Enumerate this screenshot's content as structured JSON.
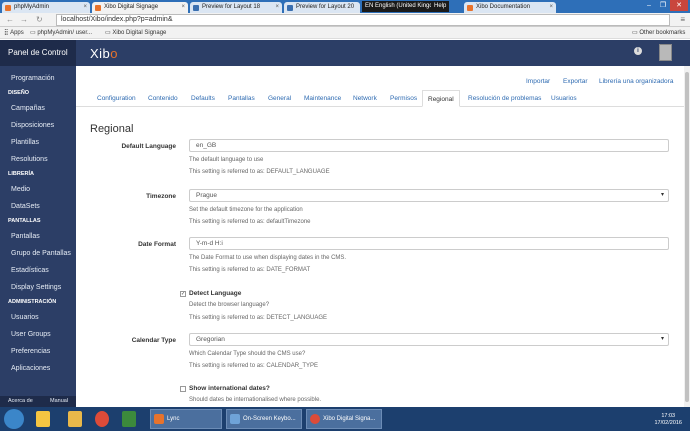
{
  "browser": {
    "tabs": [
      {
        "label": "phpMyAdmin"
      },
      {
        "label": "Xibo Digital Signage"
      },
      {
        "label": "Preview for Layout 18"
      },
      {
        "label": "Preview for Layout 20"
      },
      {
        "label": "Xibo Documentation"
      }
    ],
    "lang_badge": "EN English (United Kingdom)",
    "help_label": "Help",
    "url": "localhost/Xibo/index.php?p=admin&",
    "bookmarks": {
      "apps": "Apps",
      "phpmyadmin": "phpMyAdmin/ user...",
      "xibo": "Xibo Digital Signage",
      "other": "Other bookmarks"
    }
  },
  "sidebar": {
    "title": "Panel de Control",
    "items": [
      {
        "label": "Programación"
      },
      {
        "section": "DISEÑO"
      },
      {
        "label": "Campañas"
      },
      {
        "label": "Disposiciones"
      },
      {
        "label": "Plantillas"
      },
      {
        "label": "Resolutions"
      },
      {
        "section": "LIBRERÍA"
      },
      {
        "label": "Medio"
      },
      {
        "label": "DataSets"
      },
      {
        "section": "PANTALLAS"
      },
      {
        "label": "Pantallas"
      },
      {
        "label": "Grupo de Pantallas"
      },
      {
        "label": "Estadísticas"
      },
      {
        "label": "Display Settings"
      },
      {
        "section": "ADMINISTRACIÓN"
      },
      {
        "label": "Usuarios"
      },
      {
        "label": "User Groups"
      },
      {
        "label": "Preferencias"
      },
      {
        "label": "Aplicaciones"
      }
    ],
    "footer": {
      "about": "Acerca de",
      "manual": "Manual"
    }
  },
  "header": {
    "logo_main": "Xib",
    "logo_accent": "o"
  },
  "main": {
    "top_links": [
      "Importar",
      "Exportar",
      "Librería una organizadora"
    ],
    "tabs": [
      {
        "label": "Configuration"
      },
      {
        "label": "Contenido"
      },
      {
        "label": "Defaults"
      },
      {
        "label": "Pantallas"
      },
      {
        "label": "General"
      },
      {
        "label": "Maintenance"
      },
      {
        "label": "Network"
      },
      {
        "label": "Permisos"
      },
      {
        "label": "Regional"
      },
      {
        "label": "Resolución de problemas"
      },
      {
        "label": "Usuarios"
      }
    ],
    "section_title": "Regional",
    "fields": {
      "default_language": {
        "label": "Default Language",
        "value": "en_GB",
        "help": "The default language to use",
        "ref": "This setting is referred to as: DEFAULT_LANGUAGE"
      },
      "timezone": {
        "label": "Timezone",
        "value": "Prague",
        "help": "Set the default timezone for the application",
        "ref": "This setting is referred to as: defaultTimezone"
      },
      "date_format": {
        "label": "Date Format",
        "value": "Y-m-d H:i",
        "help": "The Date Format to use when displaying dates in the CMS.",
        "ref": "This setting is referred to as: DATE_FORMAT"
      },
      "detect_language": {
        "label": "Detect Language",
        "checked": true,
        "help": "Detect the browser language?",
        "ref": "This setting is referred to as: DETECT_LANGUAGE"
      },
      "calendar_type": {
        "label": "Calendar Type",
        "value": "Gregorian",
        "help": "Which Calendar Type should the CMS use?",
        "ref": "This setting is referred to as: CALENDAR_TYPE"
      },
      "show_international_dates": {
        "label": "Show international dates?",
        "checked": false,
        "help": "Should dates be internationalised where possible."
      }
    }
  },
  "taskbar": {
    "apps": [
      {
        "label": "Lync"
      },
      {
        "label": "On-Screen Keybo..."
      },
      {
        "label": "Xibo Digital Signa..."
      }
    ],
    "time": "17:03",
    "date": "17/02/2016"
  },
  "colors": {
    "sidebar_bg": "#2c3e66",
    "accent": "#e8732c",
    "link": "#2d6ab1",
    "taskbar": "#1c3f6e",
    "browser_frame": "#2e6fb8"
  }
}
